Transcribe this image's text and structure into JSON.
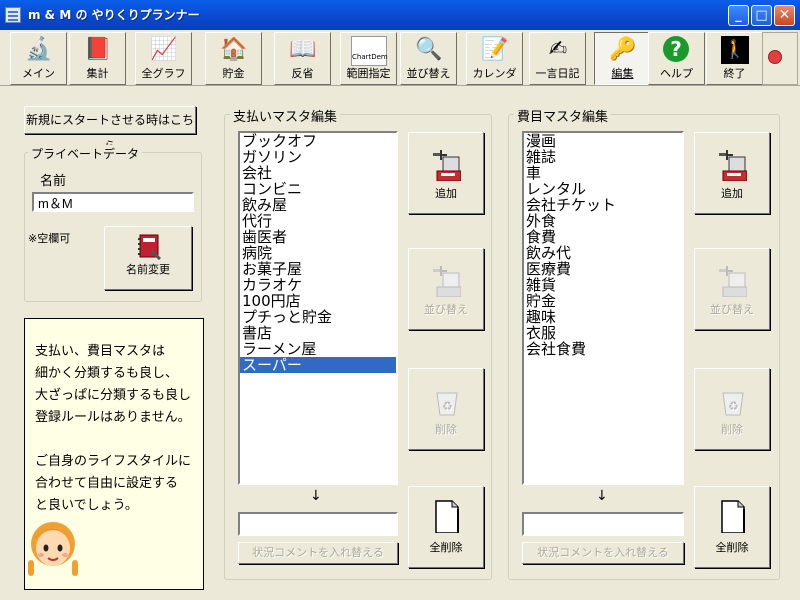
{
  "window": {
    "title": "m & M の やりくりプランナー",
    "minimize": "_",
    "maximize": "□",
    "close": "✕"
  },
  "toolbar": {
    "buttons": [
      {
        "label": "メイン",
        "icon": "🔬"
      },
      {
        "label": "集計",
        "icon": "📕"
      },
      {
        "label": "全グラフ",
        "icon": "📈"
      },
      {
        "label": "貯金",
        "icon": "🏠"
      },
      {
        "label": "反省",
        "icon": "📖"
      },
      {
        "label": "範囲指定",
        "icon": "ChartDem"
      },
      {
        "label": "並び替え",
        "icon": "🔍"
      },
      {
        "label": "カレンダ",
        "icon": "📝"
      },
      {
        "label": "一言日記",
        "icon": "✍"
      },
      {
        "label": "編集",
        "icon": "🔑"
      },
      {
        "label": "ヘルプ",
        "icon": "?"
      },
      {
        "label": "終了",
        "icon": "🚶"
      }
    ],
    "selected": "編集"
  },
  "left": {
    "new_start_button": "新規にスタートさせる時はこちら",
    "private_group": "プライベートデータ",
    "name_label": "名前",
    "name_value": "m＆M",
    "blank_ok": "※空欄可",
    "rename_button": "名前変更",
    "note_lines": [
      "支払い、費目マスタは",
      "細かく分類するも良し、",
      "大ざっぱに分類するも良し",
      "登録ルールはありません。",
      "",
      "ご自身のライフスタイルに",
      "合わせて自由に設定する",
      "と良いでしょう。"
    ]
  },
  "payment": {
    "title": "支払いマスタ編集",
    "items": [
      "ブックオフ",
      "ガソリン",
      "会社",
      "コンビニ",
      "飲み屋",
      "代行",
      "歯医者",
      "病院",
      "お菓子屋",
      "カラオケ",
      "100円店",
      "プチっと貯金",
      "書店",
      "ラーメン屋",
      "スーパー"
    ],
    "selected": "スーパー",
    "add": "追加",
    "sort": "並び替え",
    "delete": "削除",
    "delete_all": "全削除",
    "arrow": "↓",
    "replace_button": "状況コメントを入れ替える"
  },
  "expense": {
    "title": "費目マスタ編集",
    "items": [
      "漫画",
      "雑誌",
      "車",
      "レンタル",
      "会社チケット",
      "外食",
      "食費",
      "飲み代",
      "医療費",
      "雑貨",
      "貯金",
      "趣味",
      "衣服",
      "会社食費"
    ],
    "add": "追加",
    "sort": "並び替え",
    "delete": "削除",
    "delete_all": "全削除",
    "arrow": "↓",
    "replace_button": "状況コメントを入れ替える"
  },
  "colors": {
    "title_bar": "#0a52dc",
    "selection": "#316ac5",
    "note_bg": "#ffffe6"
  }
}
